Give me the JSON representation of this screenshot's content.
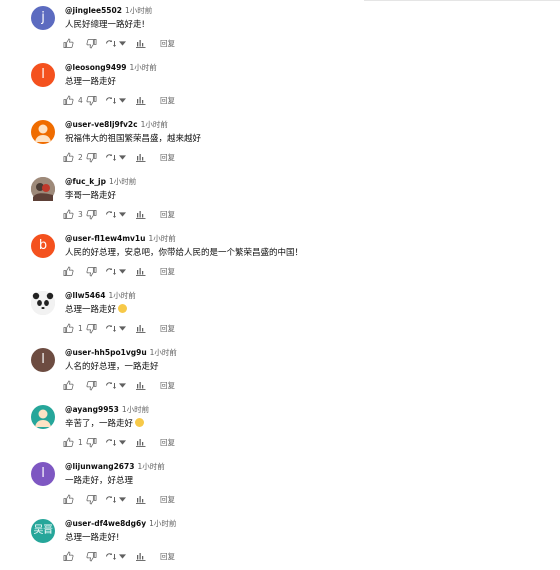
{
  "reply_label": "回复",
  "comments": [
    {
      "author": "@jinglee5502",
      "time": "1小时前",
      "text": "人民好總理一路好走!",
      "likes": "",
      "avatar": {
        "letter": "j",
        "color": "#5c6bc0"
      }
    },
    {
      "author": "@leosong9499",
      "time": "1小时前",
      "text": "总理一路走好",
      "likes": "4",
      "avatar": {
        "letter": "l",
        "color": "#f4511e"
      }
    },
    {
      "author": "@user-ve8lj9fv2c",
      "time": "1小时前",
      "text": "祝福伟大的祖国繁荣昌盛，越来越好",
      "likes": "2",
      "avatar": {
        "letter": "",
        "color": "#ef6c00",
        "kind": "user-silhouette"
      }
    },
    {
      "author": "@fuc_k_jp",
      "time": "1小时前",
      "text": "李哥一路走好",
      "likes": "3",
      "avatar": {
        "letter": "",
        "color": "#8d6e63",
        "kind": "photo"
      }
    },
    {
      "author": "@user-fl1ew4mv1u",
      "time": "1小时前",
      "text": "人民的好总理，安息吧，你带给人民的是一个繁荣昌盛的中国！",
      "likes": "",
      "avatar": {
        "letter": "b",
        "color": "#f4511e"
      }
    },
    {
      "author": "@llw5464",
      "time": "1小时前",
      "text": "总理一路走好",
      "likes": "1",
      "emoji": true,
      "avatar": {
        "letter": "",
        "color": "#e0e0e0",
        "kind": "panda"
      }
    },
    {
      "author": "@user-hh5po1vg9u",
      "time": "1小时前",
      "text": "人名的好总理，一路走好",
      "likes": "",
      "avatar": {
        "letter": "l",
        "color": "#6d4c41"
      }
    },
    {
      "author": "@ayang9953",
      "time": "1小时前",
      "text": "辛苦了，一路走好",
      "likes": "1",
      "emoji": true,
      "avatar": {
        "letter": "",
        "color": "#26a69a",
        "kind": "user-silhouette"
      }
    },
    {
      "author": "@lijunwang2673",
      "time": "1小时前",
      "text": "一路走好，好总理",
      "likes": "",
      "avatar": {
        "letter": "l",
        "color": "#7e57c2"
      }
    },
    {
      "author": "@user-df4we8dg6y",
      "time": "1小时前",
      "text": "总理一路走好!",
      "likes": "",
      "avatar": {
        "letter": "吴晋",
        "color": "#26a69a",
        "small": true
      }
    }
  ]
}
